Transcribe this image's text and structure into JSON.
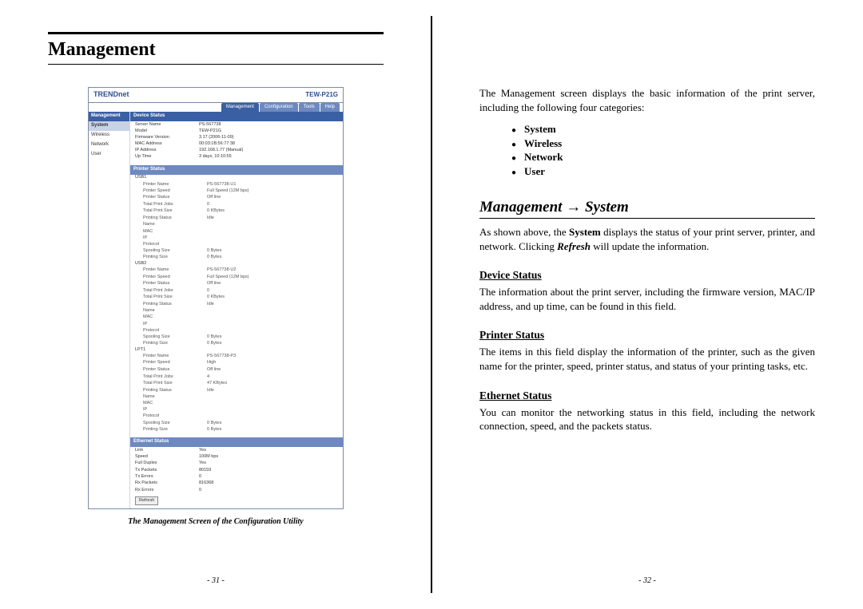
{
  "left": {
    "heading": "Management",
    "caption": "The Management Screen of the Configuration Utility",
    "page_number": "- 31 -",
    "shot": {
      "brand": "TRENDnet",
      "model": "TEW-P21G",
      "tabs": [
        "Management",
        "Configuration",
        "Tools",
        "Help"
      ],
      "sidebar_title": "Management",
      "sidebar_items": [
        "System",
        "Wireless",
        "Network",
        "User"
      ],
      "device_status_title": "Device Status",
      "device_status": [
        [
          "Server Name",
          "PS-567738"
        ],
        [
          "Model",
          "TEW-P21G"
        ],
        [
          "Firmware Version",
          "3.17 (2006-11-09)"
        ],
        [
          "MAC Address",
          "00:03:1B:56:77:38"
        ],
        [
          "IP Address",
          "192.168.1.77 (Manual)"
        ],
        [
          "Up Time",
          "3 days, 10:10:55"
        ]
      ],
      "printer_status_title": "Printer Status",
      "usb1_label": "USB1",
      "usb1": [
        [
          "Printer Name",
          "PS-567738-U1"
        ],
        [
          "Printer Speed",
          "Full Speed (12M bps)"
        ],
        [
          "Printer Status",
          "Off line"
        ],
        [
          "",
          ""
        ],
        [
          "Total Print Jobs",
          "0"
        ],
        [
          "Total Print Size",
          "0 KBytes"
        ],
        [
          "",
          ""
        ],
        [
          "Printing Status",
          "Idle"
        ],
        [
          "Name",
          ""
        ],
        [
          "MAC",
          ""
        ],
        [
          "IP",
          ""
        ],
        [
          "Protocol",
          ""
        ],
        [
          "Spooling Size",
          "0 Bytes"
        ],
        [
          "Printing Size",
          "0 Bytes"
        ]
      ],
      "usb2_label": "USB2",
      "usb2": [
        [
          "Printer Name",
          "PS-567738-U2"
        ],
        [
          "Printer Speed",
          "Full Speed (12M bps)"
        ],
        [
          "Printer Status",
          "Off line"
        ],
        [
          "",
          ""
        ],
        [
          "Total Print Jobs",
          "0"
        ],
        [
          "Total Print Size",
          "0 KBytes"
        ],
        [
          "",
          ""
        ],
        [
          "Printing Status",
          "Idle"
        ],
        [
          "Name",
          ""
        ],
        [
          "MAC",
          ""
        ],
        [
          "IP",
          ""
        ],
        [
          "Protocol",
          ""
        ],
        [
          "Spooling Size",
          "0 Bytes"
        ],
        [
          "Printing Size",
          "0 Bytes"
        ]
      ],
      "lpt1_label": "LPT1",
      "lpt1": [
        [
          "Printer Name",
          "PS-567738-P3"
        ],
        [
          "Printer Speed",
          "High"
        ],
        [
          "Printer Status",
          "Off line"
        ],
        [
          "",
          ""
        ],
        [
          "Total Print Jobs",
          "4"
        ],
        [
          "Total Print Size",
          "47 KBytes"
        ],
        [
          "",
          ""
        ],
        [
          "Printing Status",
          "Idle"
        ],
        [
          "Name",
          ""
        ],
        [
          "MAC",
          ""
        ],
        [
          "IP",
          ""
        ],
        [
          "Protocol",
          ""
        ],
        [
          "Spooling Size",
          "0 Bytes"
        ],
        [
          "Printing Size",
          "0 Bytes"
        ]
      ],
      "ethernet_status_title": "Ethernet Status",
      "ethernet": [
        [
          "Link",
          "Yes"
        ],
        [
          "Speed",
          "100M bps"
        ],
        [
          "Full Duplex",
          "Yes"
        ],
        [
          "",
          ""
        ],
        [
          "Tx Packets",
          "80159"
        ],
        [
          "Tx Errors",
          "0"
        ],
        [
          "Rx Packets",
          "816368"
        ],
        [
          "Rx Errors",
          "0"
        ]
      ],
      "refresh_btn": "Refresh"
    }
  },
  "right": {
    "intro": "The Management screen displays the basic information of the print server, including the following four categories:",
    "bullets": [
      "System",
      "Wireless",
      "Network",
      "User"
    ],
    "h2_a": "Management ",
    "h2_arrow": "→",
    "h2_b": " System",
    "p1_a": "As shown above, the ",
    "p1_b": "System",
    "p1_c": " displays the status of your print server, printer, and network.   Clicking ",
    "p1_d": "Refresh",
    "p1_e": " will update the information.",
    "h3_1": "Device Status",
    "p2": "The information about the print server, including the firmware version, MAC/IP address, and up time, can be found in this field.",
    "h3_2": "Printer Status",
    "p3": "The items in this field display the information of the printer, such as the given name for the printer, speed, printer status, and status of your printing tasks, etc.",
    "h3_3": "Ethernet Status",
    "p4": "You can monitor the networking status in this field, including the network connection, speed, and the packets status.",
    "page_number": "- 32 -"
  }
}
